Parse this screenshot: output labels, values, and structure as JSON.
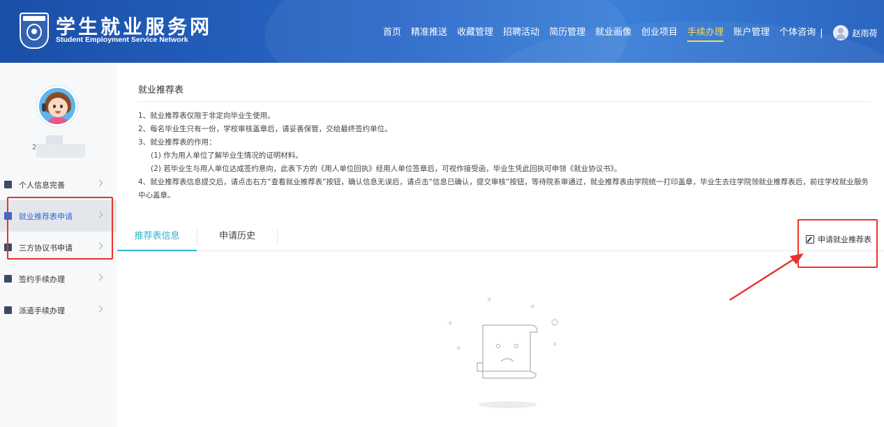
{
  "header": {
    "site_title": "学生就业服务网",
    "site_subtitle": "Student Employment Service Network",
    "nav": [
      "首页",
      "精准推送",
      "收藏管理",
      "招聘活动",
      "简历管理",
      "就业画像",
      "创业项目",
      "手续办理",
      "账户管理",
      "个体咨询"
    ],
    "active_nav": "手续办理",
    "divider": "|",
    "user_name": "赵雨荷"
  },
  "sidebar": {
    "user_id_partial": "2",
    "items": [
      {
        "label": "个人信息完善",
        "icon": "users-icon"
      },
      {
        "label": "就业推荐表申请",
        "icon": "document-icon",
        "active": true
      },
      {
        "label": "三方协议书申请",
        "icon": "contract-icon"
      },
      {
        "label": "签约手续办理",
        "icon": "grid-icon"
      },
      {
        "label": "派遣手续办理",
        "icon": "id-card-icon"
      }
    ]
  },
  "main": {
    "title": "就业推荐表",
    "rules": [
      "1、就业推荐表仅限于非定向毕业生使用。",
      "2、每名毕业生只有一份，学校审核盖章后，请妥善保管，交给最终签约单位。",
      "3、就业推荐表的作用：",
      "(1) 作为用人单位了解毕业生情况的证明材料。",
      "(2) 若毕业生与用人单位达成签约意向，此表下方的《用人单位回执》经用人单位签章后，可视作接受函，毕业生凭此回执可申领《就业协议书》。",
      "4、就业推荐表信息提交后，请点击右方“查看就业推荐表”按钮，确认信息无误后，请点击“信息已确认，提交审核”按钮，等待院系审通过，就业推荐表由学院统一打印盖章，毕业生去往学院领就业推荐表后，前往学校就业服务中心盖章。"
    ],
    "tabs": [
      "推荐表信息",
      "申请历史"
    ],
    "apply_button": "申请就业推荐表"
  },
  "colors": {
    "header_blue": "#2a68c8",
    "active_nav": "#ffd84a",
    "tab_active": "#2fb3c9",
    "annotation_red": "#e8332a"
  }
}
